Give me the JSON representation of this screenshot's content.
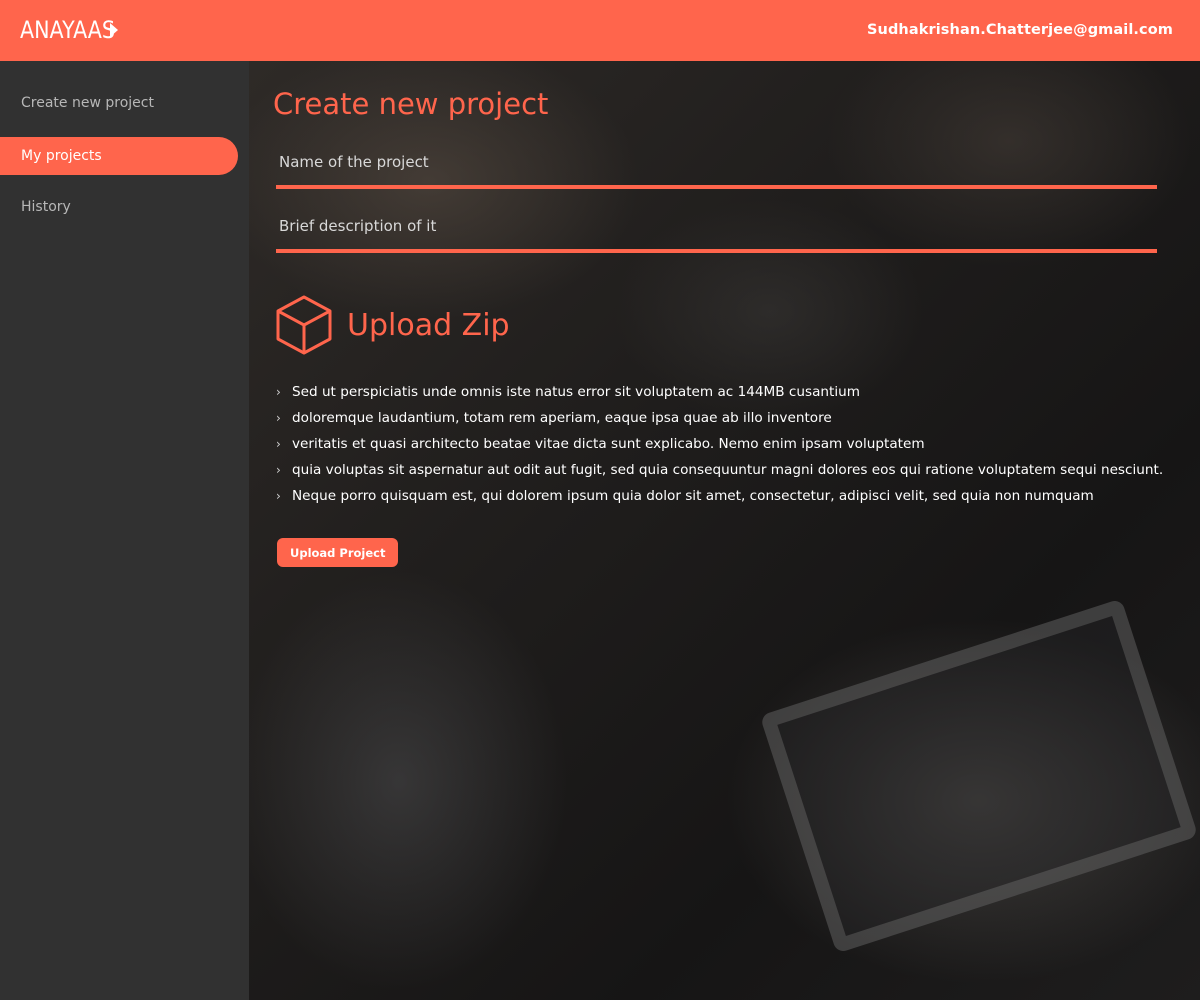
{
  "header": {
    "logo_text": "ANAYAAS",
    "user_email": "Sudhakrishan.Chatterjee@gmail.com"
  },
  "sidebar": {
    "items": [
      {
        "label": "Create new project",
        "active": false
      },
      {
        "label": "My projects",
        "active": true
      },
      {
        "label": "History",
        "active": false
      }
    ]
  },
  "main": {
    "title": "Create new project",
    "fields": {
      "name_placeholder": "Name of the project",
      "description_placeholder": "Brief description of it"
    },
    "upload_zip": {
      "label": "Upload Zip",
      "icon": "cube-icon"
    },
    "bullets": [
      "Sed ut perspiciatis unde omnis iste natus error sit voluptatem ac 144MB cusantium",
      "doloremque laudantium, totam rem aperiam, eaque ipsa quae ab illo inventore",
      "veritatis et quasi architecto beatae vitae dicta sunt explicabo. Nemo enim ipsam voluptatem",
      "quia voluptas sit aspernatur aut odit aut fugit, sed quia consequuntur magni dolores eos qui ratione voluptatem sequi nesciunt.",
      "Neque porro quisquam est, qui dolorem ipsum quia dolor sit amet, consectetur, adipisci velit, sed quia non numquam"
    ],
    "upload_button_label": "Upload Project"
  },
  "colors": {
    "accent": "#ff654c",
    "sidebar_bg": "#313131",
    "text_light": "#ffffff"
  }
}
